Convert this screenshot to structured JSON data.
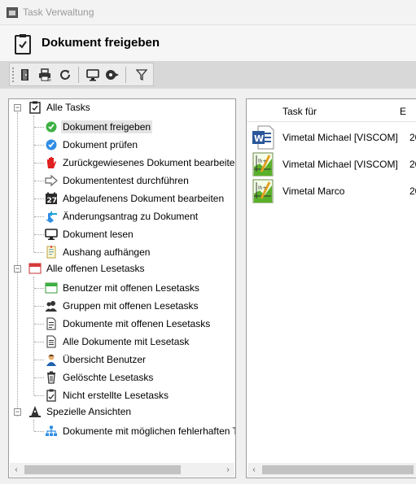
{
  "window": {
    "title": "Task Verwaltung"
  },
  "page": {
    "title": "Dokument freigeben"
  },
  "toolbar": {
    "buttons": [
      {
        "name": "door-icon"
      },
      {
        "name": "print-icon"
      },
      {
        "name": "refresh-icon"
      },
      {
        "name": "monitor-icon"
      },
      {
        "name": "forward-icon"
      },
      {
        "name": "filter-icon"
      }
    ]
  },
  "tree": {
    "groups": [
      {
        "label": "Alle Tasks",
        "expander": "−",
        "items": [
          {
            "label": "Dokument freigeben",
            "icon": "check-green-icon",
            "selected": true
          },
          {
            "label": "Dokument prüfen",
            "icon": "check-blue-icon"
          },
          {
            "label": "Zurückgewiesenes Dokument bearbeiten",
            "icon": "red-hand-icon"
          },
          {
            "label": "Dokumententest durchführen",
            "icon": "arrow-right-outline-icon"
          },
          {
            "label": "Abgelaufenens Dokument bearbeiten",
            "icon": "calendar-27-icon"
          },
          {
            "label": "Änderungsantrag zu Dokument",
            "icon": "change-arrows-icon"
          },
          {
            "label": "Dokument lesen",
            "icon": "monitor-icon"
          },
          {
            "label": "Aushang aufhängen",
            "icon": "notice-icon"
          }
        ]
      },
      {
        "label": "Alle offenen Lesetasks",
        "expander": "−",
        "items": [
          {
            "label": "Benutzer mit offenen Lesetasks",
            "icon": "green-calendar-icon"
          },
          {
            "label": "Gruppen mit offenen Lesetasks",
            "icon": "users-icon"
          },
          {
            "label": "Dokumente mit offenen Lesetasks",
            "icon": "document-icon"
          },
          {
            "label": "Alle Dokumente mit Lesetask",
            "icon": "document-lines-icon"
          },
          {
            "label": "Übersicht Benutzer",
            "icon": "user-icon"
          },
          {
            "label": "Gelöschte Lesetasks",
            "icon": "trash-icon"
          },
          {
            "label": "Nicht erstellte Lesetasks",
            "icon": "clipboard-icon"
          }
        ]
      },
      {
        "label": "Spezielle Ansichten",
        "expander": "−",
        "items": [
          {
            "label": "Dokumente mit möglichen fehlerhaften T",
            "icon": "org-chart-icon"
          }
        ]
      }
    ]
  },
  "grid": {
    "columns": [
      "Task für",
      "E"
    ],
    "rows": [
      {
        "user": "Vimetal Michael [VISCOM]",
        "col2": "20",
        "icon": "word-doc-icon"
      },
      {
        "user": "Vimetal Michael [VISCOM]",
        "col2": "20",
        "icon": "chart-doc-icon"
      },
      {
        "user": "Vimetal Marco",
        "col2": "20",
        "icon": "chart-doc-icon"
      }
    ]
  },
  "colors": {
    "accent_green": "#3cb043",
    "accent_blue": "#2f8de4",
    "red": "#e02020"
  }
}
